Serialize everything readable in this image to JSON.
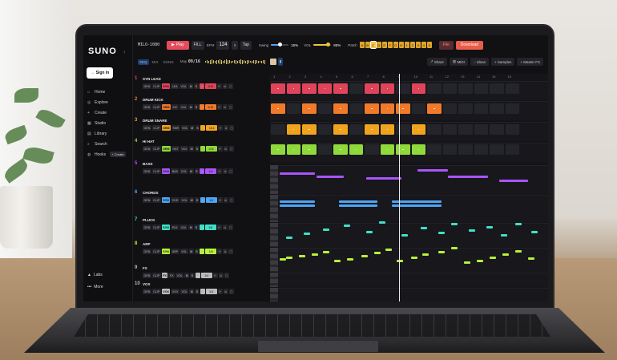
{
  "app": {
    "logo": "SUNO",
    "project": "MILO-1080"
  },
  "sidebar": {
    "sign_in": "Sign In",
    "items": [
      {
        "label": "Home",
        "icon": "home-icon"
      },
      {
        "label": "Explore",
        "icon": "compass-icon"
      },
      {
        "label": "Create",
        "icon": "plus-icon"
      },
      {
        "label": "Studio",
        "icon": "studio-icon"
      },
      {
        "label": "Library",
        "icon": "library-icon"
      },
      {
        "label": "Search",
        "icon": "search-icon"
      },
      {
        "label": "Hooks",
        "icon": "hook-icon"
      }
    ],
    "create_badge": "+ Create",
    "labs": "Labs",
    "more": "More"
  },
  "toolbar": {
    "play": "Play",
    "fill": "FILL",
    "bpm_label": "BPM",
    "bpm": "124",
    "tap": "Tap",
    "swing_label": "Swing",
    "swing_value": "15%",
    "swing_fraction": 0.15,
    "vol_label": "VOL",
    "vol_value": "85%",
    "vol_fraction": 0.85,
    "patch_label": "Patch",
    "patches": [
      "A",
      "B",
      "C",
      "D",
      "E",
      "F",
      "G",
      "H",
      "1",
      "2",
      "3",
      "4",
      "5"
    ],
    "active_patch": "C",
    "file": "File",
    "download": "Download"
  },
  "subbar": {
    "modes": [
      "SEQ",
      "MIX",
      "SONG"
    ],
    "active_mode": "SEQ",
    "map_label": "Map",
    "map_value": "09/16",
    "share": "Share",
    "midi": "MIDI",
    "ideas": "Ideas",
    "samples": "Samples",
    "master_fx": "Master FX"
  },
  "ruler": [
    "1",
    "2",
    "3",
    "4",
    "5",
    "6",
    "7",
    "8",
    "9",
    "10",
    "11",
    "12",
    "13",
    "14",
    "15",
    "16"
  ],
  "tracks": [
    {
      "num": "1",
      "name": "SYN LEAD",
      "type": "SYN",
      "preset": "LEA",
      "color": "#e0445a",
      "step": "1/16"
    },
    {
      "num": "2",
      "name": "DRUM KICK",
      "type": "DRM",
      "preset": "KIC",
      "color": "#f07a2a",
      "step": "1/16"
    },
    {
      "num": "3",
      "name": "DRUM SNARE",
      "type": "DRM",
      "preset": "SNR",
      "color": "#f0a41e",
      "step": "1/11"
    },
    {
      "num": "4",
      "name": "HI HAT",
      "type": "DRM",
      "preset": "HAT",
      "color": "#8fd93a",
      "step": "1/11"
    },
    {
      "num": "5",
      "name": "BASS",
      "type": "SYN",
      "preset": "BAS",
      "color": "#a855f7",
      "step": "1/4"
    },
    {
      "num": "6",
      "name": "CHORDS",
      "type": "SYN",
      "preset": "CHD",
      "color": "#4ea4f5",
      "step": "1/4"
    },
    {
      "num": "7",
      "name": "PLUCK",
      "type": "SYN",
      "preset": "PLK",
      "color": "#3fe0c5",
      "step": "1/8"
    },
    {
      "num": "8",
      "name": "ARP",
      "type": "SYN",
      "preset": "ARP",
      "color": "#b6f03c",
      "step": "1/8"
    },
    {
      "num": "9",
      "name": "FX",
      "type": "FX",
      "preset": "FX",
      "color": "#bbbbbb",
      "step": "1/4"
    },
    {
      "num": "10",
      "name": "VOX",
      "type": "VOX",
      "preset": "VOX",
      "color": "#bbbbbb",
      "step": "1/4"
    }
  ],
  "labels": {
    "gen": "GEN",
    "clip": "CLIP",
    "vol": "VOL",
    "mute": "M",
    "solo": "S"
  },
  "pattern": {
    "steps": 16,
    "playhead_step": 9,
    "lead_on": [
      1,
      2,
      3,
      4,
      5,
      7,
      8,
      10
    ],
    "kick_on": [
      1,
      3,
      5,
      7,
      8,
      9,
      11
    ],
    "snare_on": [
      2,
      3,
      5,
      7,
      8,
      10
    ],
    "hat_on": [
      1,
      2,
      3,
      5,
      6,
      8,
      9,
      10
    ]
  }
}
